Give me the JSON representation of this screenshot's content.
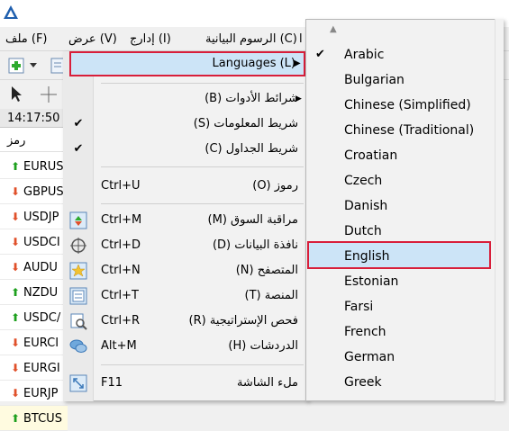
{
  "menubar": {
    "file": "ملف (F)",
    "view": "عرض (V)",
    "insert": "إدارج (I)",
    "charts": "الرسوم البيانية (C)",
    "extra": "ا"
  },
  "market_watch": {
    "time": "14:17:50",
    "symbol_header": "رمز",
    "rows": [
      {
        "symbol": "EURUS",
        "dir": "up"
      },
      {
        "symbol": "GBPUS",
        "dir": "down"
      },
      {
        "symbol": "USDJP",
        "dir": "down"
      },
      {
        "symbol": "USDCI",
        "dir": "down"
      },
      {
        "symbol": "AUDU",
        "dir": "down"
      },
      {
        "symbol": "NZDU",
        "dir": "up"
      },
      {
        "symbol": "USDC/",
        "dir": "up"
      },
      {
        "symbol": "EURCI",
        "dir": "down"
      },
      {
        "symbol": "EURGI",
        "dir": "down"
      },
      {
        "symbol": "EURJP",
        "dir": "down"
      },
      {
        "symbol": "BTCUS",
        "dir": "up"
      }
    ]
  },
  "view_menu": {
    "languages": "Languages (L)",
    "toolbars": "شرائط الأدوات (B)",
    "status_bar": "شريط المعلومات (S)",
    "tabs_bar": "شريط الجداول (C)",
    "symbols": {
      "label": "رموز (O)",
      "shortcut": "Ctrl+U"
    },
    "market_watch": {
      "label": "مراقبة السوق (M)",
      "shortcut": "Ctrl+M"
    },
    "data_window": {
      "label": "نافذة البيانات (D)",
      "shortcut": "Ctrl+D"
    },
    "navigator": {
      "label": "المتصفح (N)",
      "shortcut": "Ctrl+N"
    },
    "terminal": {
      "label": "المنصة (T)",
      "shortcut": "Ctrl+T"
    },
    "strategy_tester": {
      "label": "فحص الإستراتيجية (R)",
      "shortcut": "Ctrl+R"
    },
    "chats": {
      "label": "الدردشات (H)",
      "shortcut": "Alt+M"
    },
    "fullscreen": {
      "label": "ملء الشاشة",
      "shortcut": "F11"
    }
  },
  "languages_menu": {
    "items": [
      "Arabic",
      "Bulgarian",
      "Chinese (Simplified)",
      "Chinese (Traditional)",
      "Croatian",
      "Czech",
      "Danish",
      "Dutch",
      "English",
      "Estonian",
      "Farsi",
      "French",
      "German",
      "Greek"
    ],
    "checked": "Arabic",
    "highlighted": "English"
  },
  "colors": {
    "highlight_border": "#d81e3a",
    "highlight_fill": "#cce4f7",
    "up_arrow": "#1ea01e",
    "down_arrow": "#e0502a"
  }
}
